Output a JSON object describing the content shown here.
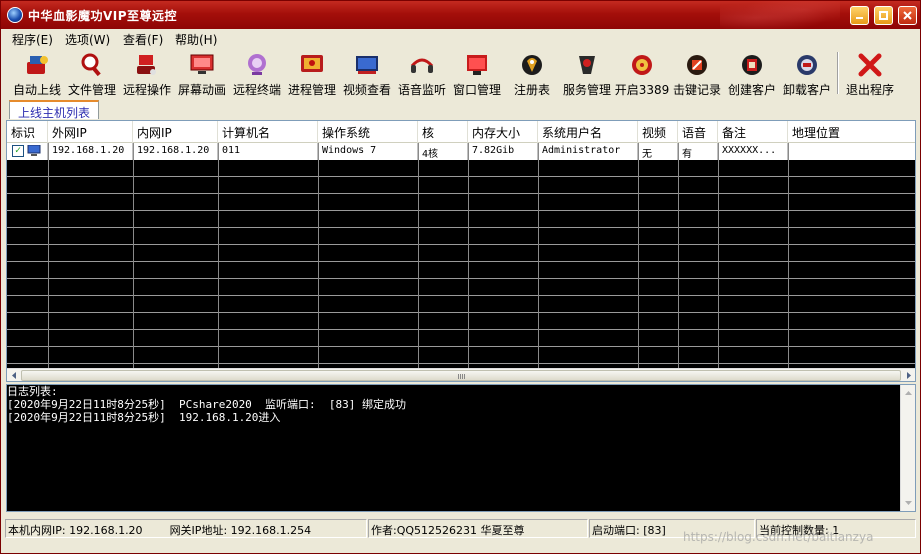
{
  "window": {
    "title": "中华血影魔功VIP至尊远控",
    "colors": {
      "titlebar": "#a40f0a",
      "accent": "#e89a18",
      "tab_text": "#2d2db0"
    }
  },
  "menu": [
    "程序(E)",
    "选项(W)",
    "查看(F)",
    "帮助(H)"
  ],
  "toolbar": [
    {
      "label": "自动上线",
      "icon": "auto-online-icon"
    },
    {
      "label": "文件管理",
      "icon": "file-manager-icon"
    },
    {
      "label": "远程操作",
      "icon": "remote-control-icon"
    },
    {
      "label": "屏幕动画",
      "icon": "screen-capture-icon"
    },
    {
      "label": "远程终端",
      "icon": "terminal-icon"
    },
    {
      "label": "进程管理",
      "icon": "process-icon"
    },
    {
      "label": "视频查看",
      "icon": "video-icon"
    },
    {
      "label": "语音监听",
      "icon": "audio-icon"
    },
    {
      "label": "窗口管理",
      "icon": "window-icon"
    },
    {
      "label": "注册表",
      "icon": "registry-icon"
    },
    {
      "label": "服务管理",
      "icon": "service-icon"
    },
    {
      "label": "开启3389",
      "icon": "rdp-icon"
    },
    {
      "label": "击键记录",
      "icon": "keylogger-icon"
    },
    {
      "label": "创建客户",
      "icon": "create-client-icon"
    },
    {
      "label": "卸载客户",
      "icon": "uninstall-client-icon"
    },
    {
      "label": "退出程序",
      "icon": "exit-icon"
    }
  ],
  "tabs": [
    "上线主机列表"
  ],
  "list": {
    "columns": [
      "标识",
      "外网IP",
      "内网IP",
      "计算机名",
      "操作系统",
      "核",
      "内存大小",
      "系统用户名",
      "视频",
      "语音",
      "备注",
      "地理位置"
    ],
    "rows": [
      [
        "",
        "192.168.1.20",
        "192.168.1.20",
        "011",
        "Windows 7",
        "4核",
        "7.82Gib",
        "Administrator",
        "无",
        "有",
        "XXXXXX...",
        ""
      ]
    ]
  },
  "log": {
    "title": "日志列表:",
    "lines": [
      "[2020年9月22日11时8分25秒]  PCshare2020  监听端口:  [83] 绑定成功",
      "[2020年9月22日11时8分25秒]  192.168.1.20进入"
    ]
  },
  "status": {
    "local_ip": "本机内网IP: 192.168.1.20",
    "gateway_ip": "网关IP地址: 192.168.1.254",
    "author": "作者:QQ512526231 华夏至尊",
    "port": "启动端口: [83]",
    "control_count": "当前控制数量: 1"
  },
  "watermark": "https://blog.csdn.net/baitianzya"
}
